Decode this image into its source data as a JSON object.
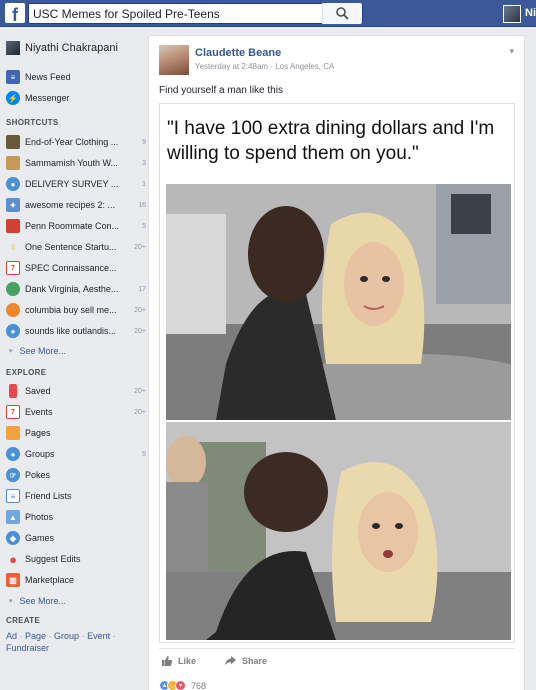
{
  "header": {
    "logo": "f",
    "search_value": "USC Memes for Spoiled Pre-Teens",
    "user_name_truncated": "Niy"
  },
  "sidebar": {
    "profile_name": "Niyathi Chakrapani",
    "main_items": [
      {
        "label": "News Feed",
        "icon": "news-feed-icon"
      },
      {
        "label": "Messenger",
        "icon": "messenger-icon"
      }
    ],
    "shortcuts_heading": "SHORTCUTS",
    "shortcuts": [
      {
        "label": "End-of-Year Clothing ...",
        "count": "9"
      },
      {
        "label": "Sammamish Youth W...",
        "count": "3"
      },
      {
        "label": "DELIVERY SURVEY ...",
        "count": "1"
      },
      {
        "label": "awesome recipes 2: ...",
        "count": "16"
      },
      {
        "label": "Penn Roommate Con...",
        "count": "5"
      },
      {
        "label": "One Sentence Startu...",
        "count": "20+"
      },
      {
        "label": "SPEC Connaissance...",
        "count": ""
      },
      {
        "label": "Dank Virginia, Aesthe...",
        "count": "17"
      },
      {
        "label": "columbia buy sell me...",
        "count": "20+"
      },
      {
        "label": "sounds like outlandis...",
        "count": "20+"
      }
    ],
    "see_more_shortcuts": "See More...",
    "explore_heading": "EXPLORE",
    "explore": [
      {
        "label": "Saved",
        "count": "20+"
      },
      {
        "label": "Events",
        "count": "20+"
      },
      {
        "label": "Pages",
        "count": ""
      },
      {
        "label": "Groups",
        "count": "5"
      },
      {
        "label": "Pokes",
        "count": ""
      },
      {
        "label": "Friend Lists",
        "count": ""
      },
      {
        "label": "Photos",
        "count": ""
      },
      {
        "label": "Games",
        "count": ""
      },
      {
        "label": "Suggest Edits",
        "count": ""
      },
      {
        "label": "Marketplace",
        "count": ""
      }
    ],
    "see_more_explore": "See More...",
    "create_heading": "CREATE",
    "create_links": [
      "Ad",
      "Page",
      "Group",
      "Event",
      "Fundraiser"
    ],
    "create_separator": " · "
  },
  "post": {
    "author": "Claudette Beane",
    "time": "Yesterday at 2:48am",
    "meta_separator": " · ",
    "location": "Los Angeles, CA",
    "text": "Find yourself a man like this",
    "meme_caption": "\"I have 100 extra dining dollars and I'm willing to spend them on you.\"",
    "actions": {
      "like": "Like",
      "share": "Share"
    },
    "reaction_count": "768"
  },
  "colors": {
    "brand_blue": "#3b5998",
    "link_blue": "#365899",
    "page_bg": "#e9ebee"
  }
}
